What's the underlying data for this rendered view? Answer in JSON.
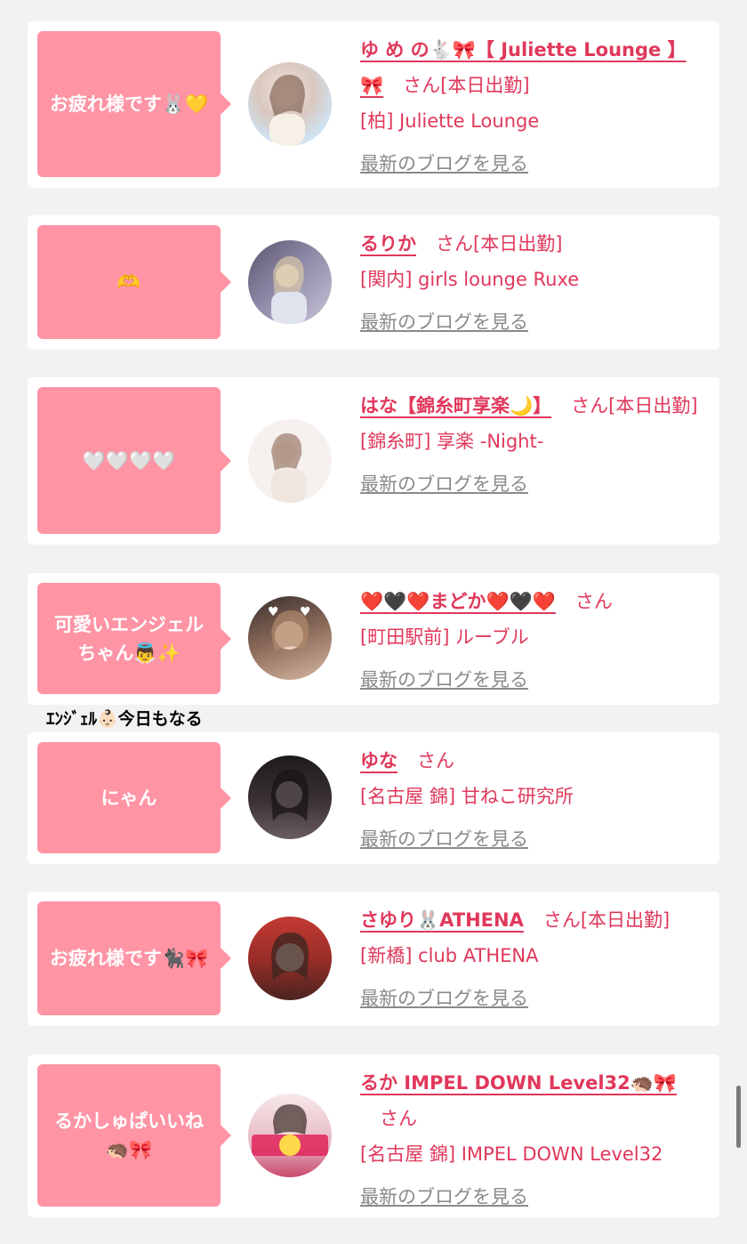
{
  "cards": [
    {
      "bubble": "お疲れ様です🐰💛",
      "name": "ゆ め の🐇🎀【 Juliette Lounge 】🎀",
      "san": "さん",
      "status": "[本日出勤]",
      "shop": "[柏] Juliette Lounge",
      "blog": "最新のブログを見る"
    },
    {
      "bubble": "🫶",
      "name": "るりか",
      "san": "さん",
      "status": "[本日出勤]",
      "shop": "[関内] girls lounge Ruxe",
      "blog": "最新のブログを見る"
    },
    {
      "bubble": "🤍🤍🤍🤍",
      "name": "はな【錦糸町享楽🌙】",
      "san": "さん",
      "status": "[本日出勤]",
      "shop": "[錦糸町] 享楽 -Night-",
      "blog": "最新のブログを見る"
    },
    {
      "bubble": "可愛いエンジェルちゃん👼✨",
      "name": "❤️🖤❤️まどか❤️🖤❤️",
      "san": "さん",
      "status": "",
      "shop": "[町田駅前] ルーブル",
      "blog": "最新のブログを見る"
    },
    {
      "bubble": "にゃん",
      "name": "ゆな",
      "san": "さん",
      "status": "",
      "shop": "[名古屋 錦] 甘ねこ研究所",
      "blog": "最新のブログを見る"
    },
    {
      "bubble": "お疲れ様です🐈‍⬛🎀",
      "name": "さゆり🐰ATHENA",
      "san": "さん",
      "status": "[本日出勤]",
      "shop": "[新橋] club ATHENA",
      "blog": "最新のブログを見る"
    },
    {
      "bubble": "るかしゅぱいいね🦔🎀",
      "name": "るか IMPEL DOWN Level32🦔🎀",
      "san": "さん",
      "status": "",
      "shop": "[名古屋 錦] IMPEL DOWN Level32",
      "blog": "最新のブログを見る"
    }
  ],
  "overflow_text": "ｴﾝｼﾞｪﾙ👶🏻今日もなる",
  "colors": {
    "bubble": "#ff94a5",
    "accent": "#e0385b",
    "link_gray": "#8a8a8a",
    "background": "#f2f2f2"
  }
}
